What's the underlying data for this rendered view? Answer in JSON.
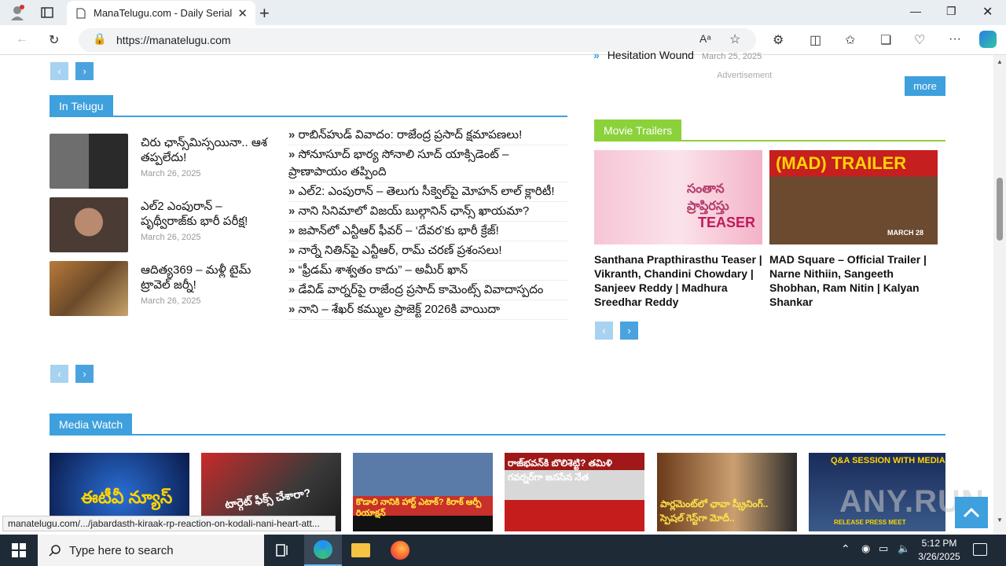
{
  "browser": {
    "tab_title": "ManaTelugu.com - Daily Serials | ",
    "url": "https://manatelugu.com",
    "status_url": "manatelugu.com/.../jabardasth-kiraak-rp-reaction-on-kodali-nani-heart-att..."
  },
  "top_right": {
    "prev_item_title": "Hesitation Wound",
    "prev_item_date": "March 25, 2025",
    "advertisement": "Advertisement",
    "more_label": "more"
  },
  "in_telugu": {
    "heading": "In Telugu",
    "featured": [
      {
        "title": "చిరు ఛాన్స్‌మిస్సయినా.. ఆశ తప్పలేదు!",
        "date": "March 26, 2025"
      },
      {
        "title": "ఎల్2 ఎంపురాన్ – పృథ్వీరాజ్‌కు భారీ పరీక్ష!",
        "date": "March 26, 2025"
      },
      {
        "title": "ఆదిత్య369 – మళ్లీ టైమ్ ట్రావెల్ జర్నీ!",
        "date": "March 26, 2025"
      }
    ],
    "list": [
      "రాబిన్‌హుడ్ వివాదం: రాజేంద్ర ప్రసాద్ క్షమాపణలు!",
      "సోనూసూద్ భార్య సోనాలి సూద్ యాక్సిడెంట్ – ప్రాణాపాయం తప్పింది",
      "ఎల్2: ఎంపురాన్ – తెలుగు సీక్వెల్‌పై మోహన్ లాల్ క్లారిటీ!",
      "నాని సినిమాలో విజయ్ బుల్గానిన్ ఛాన్స్ ఖాయమా?",
      "జపాన్‌లో ఎన్టీఆర్ ఫీవర్ – ‘దేవర’కు భారీ క్రేజ్!",
      "నార్నే నితిన్‌పై ఎన్టీఆర్, రామ్ చరణ్ ప్రశంసలు!",
      "“ఫ్రీడమ్ శాశ్వతం కాదు” – అమీర్ ఖాన్",
      "డేవిడ్ వార్నర్‌పై రాజేంద్ర ప్రసాద్ కామెంట్స్ వివాదాస్పదం",
      "నాని – శేఖర్ కమ్ముల ప్రాజెక్ట్ 2026కి వాయిదా"
    ]
  },
  "movie_trailers": {
    "heading": "Movie Trailers",
    "items": [
      {
        "caption": "Santhana Prapthirasthu Teaser | Vikranth, Chandini Chowdary | Sanjeev Reddy | Madhura Sreedhar Reddy",
        "img_text": "TEASER",
        "img_subtext": "సంతాన ప్రాప్తిరస్తు"
      },
      {
        "caption": "MAD Square – Official Trailer | Narne Nithiin, Sangeeth Shobhan, Ram Nitin | Kalyan Shankar",
        "img_text": "(MAD) TRAILER",
        "img_subtext": "MARCH 28"
      }
    ]
  },
  "media_watch": {
    "heading": "Media Watch",
    "items": [
      {
        "text": "ఈటీవీ న్యూస్"
      },
      {
        "text": "టార్గెట్ ఫిక్స్ చేశారా?"
      },
      {
        "text": "కొడాలి నానికి హార్ట్ ఎటాక్? కిరాక్ ఆర్పీ రియాక్షన్"
      },
      {
        "text": "రాజ్‌భవన్‌కి బొలిశెట్టి? తమిళి గవర్నర్‌గా జనసేన నేత"
      },
      {
        "text": "పార్లమెంట్‌లో ఛావా స్క్రీనింగ్.. స్పెషల్ గెస్ట్‌గా మోదీ.."
      },
      {
        "text": "Q&A SESSION WITH MEDIA",
        "sub": "RELEASE PRESS MEET"
      }
    ]
  },
  "taskbar": {
    "search_placeholder": "Type here to search",
    "time": "5:12 PM",
    "date": "3/26/2025"
  },
  "watermark": "ANY.RUN"
}
